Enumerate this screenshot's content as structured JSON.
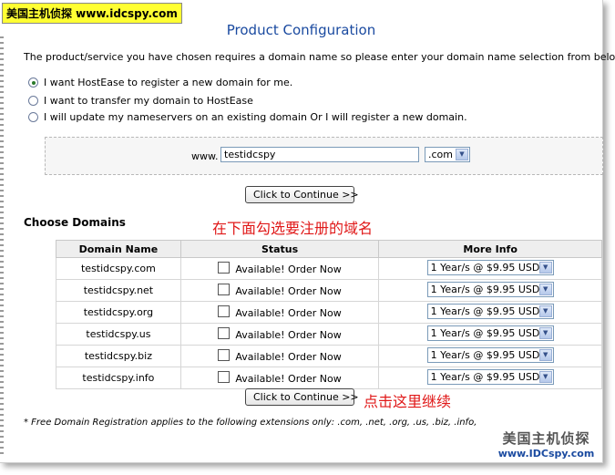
{
  "watermark": {
    "top_label": "美国主机侦探 www.idcspy.com",
    "bottom_cn": "美国主机侦探",
    "bottom_url": "www.IDCspy.com"
  },
  "page_title": "Product Configuration",
  "intro_text": "The product/service you have chosen requires a domain name so please enter your domain name selection from below.",
  "options": [
    {
      "label": "I want HostEase to register a new domain for me.",
      "checked": true
    },
    {
      "label": "I want to transfer my domain to HostEase",
      "checked": false
    },
    {
      "label": "I will update my nameservers on an existing domain Or I will register a new domain.",
      "checked": false
    }
  ],
  "domain_entry": {
    "prefix": "www.",
    "value": "testidcspy",
    "tld": ".com"
  },
  "continue_label": "Click to Continue >>",
  "section_title": "Choose Domains",
  "annotations": {
    "choose": "在下面勾选要注册的域名",
    "click": "点击这里继续"
  },
  "table": {
    "headers": [
      "Domain Name",
      "Status",
      "More Info"
    ],
    "rows": [
      {
        "domain": "testidcspy.com",
        "status": "Available! Order Now",
        "option": "1 Year/s @ $9.95 USD"
      },
      {
        "domain": "testidcspy.net",
        "status": "Available! Order Now",
        "option": "1 Year/s @ $9.95 USD"
      },
      {
        "domain": "testidcspy.org",
        "status": "Available! Order Now",
        "option": "1 Year/s @ $9.95 USD"
      },
      {
        "domain": "testidcspy.us",
        "status": "Available! Order Now",
        "option": "1 Year/s @ $9.95 USD"
      },
      {
        "domain": "testidcspy.biz",
        "status": "Available! Order Now",
        "option": "1 Year/s @ $9.95 USD"
      },
      {
        "domain": "testidcspy.info",
        "status": "Available! Order Now",
        "option": "1 Year/s @ $9.95 USD"
      }
    ]
  },
  "footnote": "* Free Domain Registration applies to the following extensions only: .com, .net, .org, .us, .biz, .info,"
}
